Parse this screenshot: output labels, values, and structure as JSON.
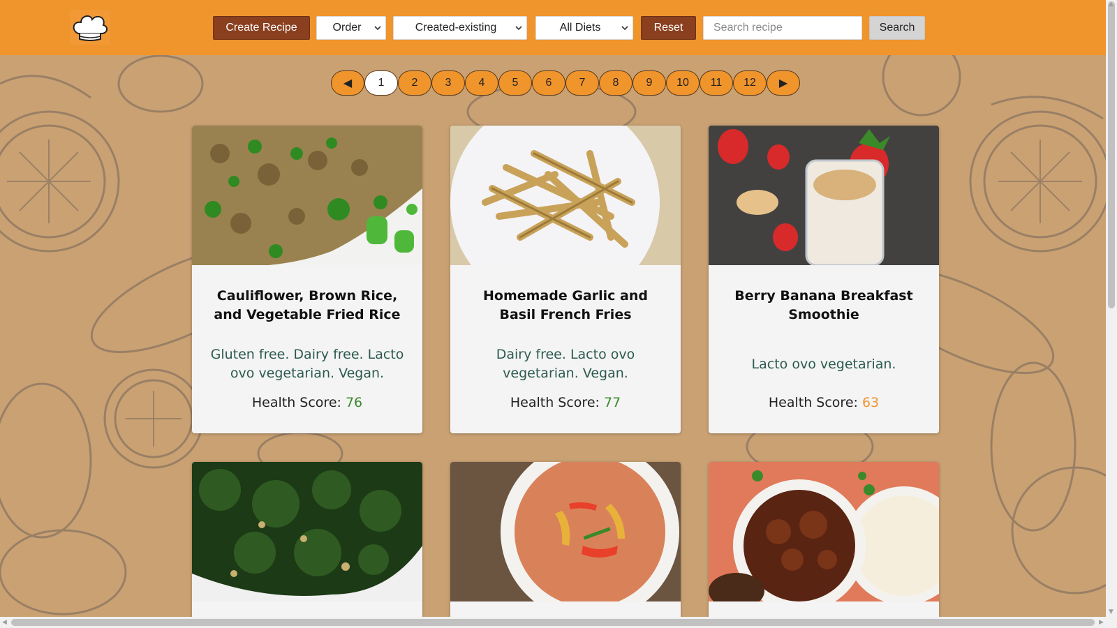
{
  "header": {
    "logo_icon": "chef-hat-icon",
    "create_label": "Create Recipe",
    "order_select": "Order",
    "source_select": "Created-existing",
    "diet_select": "All Diets",
    "reset_label": "Reset",
    "search_placeholder": "Search recipe",
    "search_label": "Search",
    "colors": {
      "bar": "#f0942c",
      "brown_button": "#8a3f1f",
      "gray_button": "#d4d4d4"
    }
  },
  "pagination": {
    "prev_label": "◀",
    "next_label": "▶",
    "pages": [
      "1",
      "2",
      "3",
      "4",
      "5",
      "6",
      "7",
      "8",
      "9",
      "10",
      "11",
      "12"
    ],
    "current": "1"
  },
  "recipes": [
    {
      "title": "Cauliflower, Brown Rice, and Vegetable Fried Rice",
      "diets": "Gluten free. Dairy free. Lacto ovo vegetarian. Vegan.",
      "health_label": "Health Score: ",
      "health_value": "76",
      "health_color": "#3a8a2a",
      "image": "fried-rice-photo"
    },
    {
      "title": "Homemade Garlic and Basil French Fries",
      "diets": "Dairy free. Lacto ovo vegetarian. Vegan.",
      "health_label": "Health Score: ",
      "health_value": "77",
      "health_color": "#3a8a2a",
      "image": "french-fries-photo"
    },
    {
      "title": "Berry Banana Breakfast Smoothie",
      "diets": "Lacto ovo vegetarian.",
      "health_label": "Health Score: ",
      "health_value": "63",
      "health_color": "#f0942c",
      "image": "smoothie-photo"
    },
    {
      "image": "kale-photo"
    },
    {
      "image": "curry-bowl-photo"
    },
    {
      "image": "stew-with-rice-photo"
    }
  ]
}
